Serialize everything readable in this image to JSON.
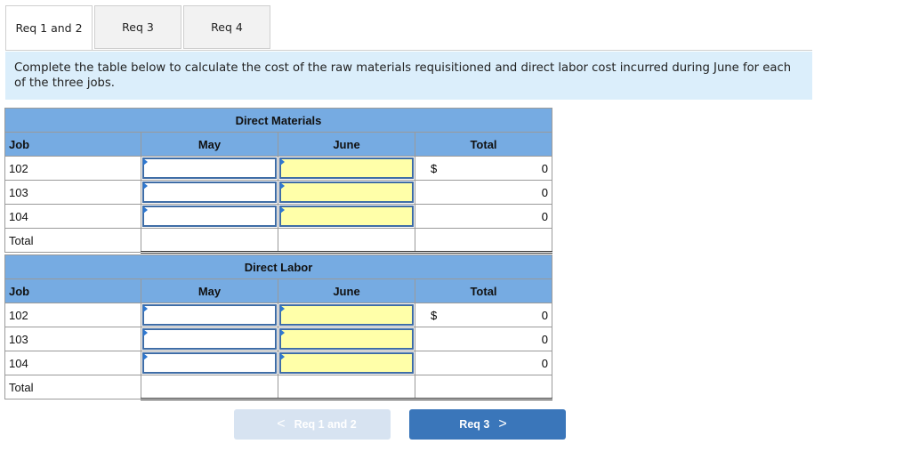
{
  "tabs": [
    {
      "label": "Req 1 and 2",
      "active": true
    },
    {
      "label": "Req 3",
      "active": false
    },
    {
      "label": "Req 4",
      "active": false
    }
  ],
  "instruction": "Complete the table below to calculate the cost of the raw materials requisitioned and direct labor cost incurred during June for each of the three jobs.",
  "direct_materials": {
    "title": "Direct Materials",
    "headers": {
      "job": "Job",
      "may": "May",
      "june": "June",
      "total": "Total"
    },
    "rows": [
      {
        "job": "102",
        "may": "",
        "june": "",
        "currency": "$",
        "total": "0"
      },
      {
        "job": "103",
        "may": "",
        "june": "",
        "currency": "",
        "total": "0"
      },
      {
        "job": "104",
        "may": "",
        "june": "",
        "currency": "",
        "total": "0"
      }
    ],
    "total_label": "Total"
  },
  "direct_labor": {
    "title": "Direct Labor",
    "headers": {
      "job": "Job",
      "may": "May",
      "june": "June",
      "total": "Total"
    },
    "rows": [
      {
        "job": "102",
        "may": "",
        "june": "",
        "currency": "$",
        "total": "0"
      },
      {
        "job": "103",
        "may": "",
        "june": "",
        "currency": "",
        "total": "0"
      },
      {
        "job": "104",
        "may": "",
        "june": "",
        "currency": "",
        "total": "0"
      }
    ],
    "total_label": "Total"
  },
  "nav": {
    "prev_label": "Req 1 and 2",
    "next_label": "Req 3",
    "prev_icon": "chevron-left-icon",
    "next_icon": "chevron-right-icon"
  }
}
